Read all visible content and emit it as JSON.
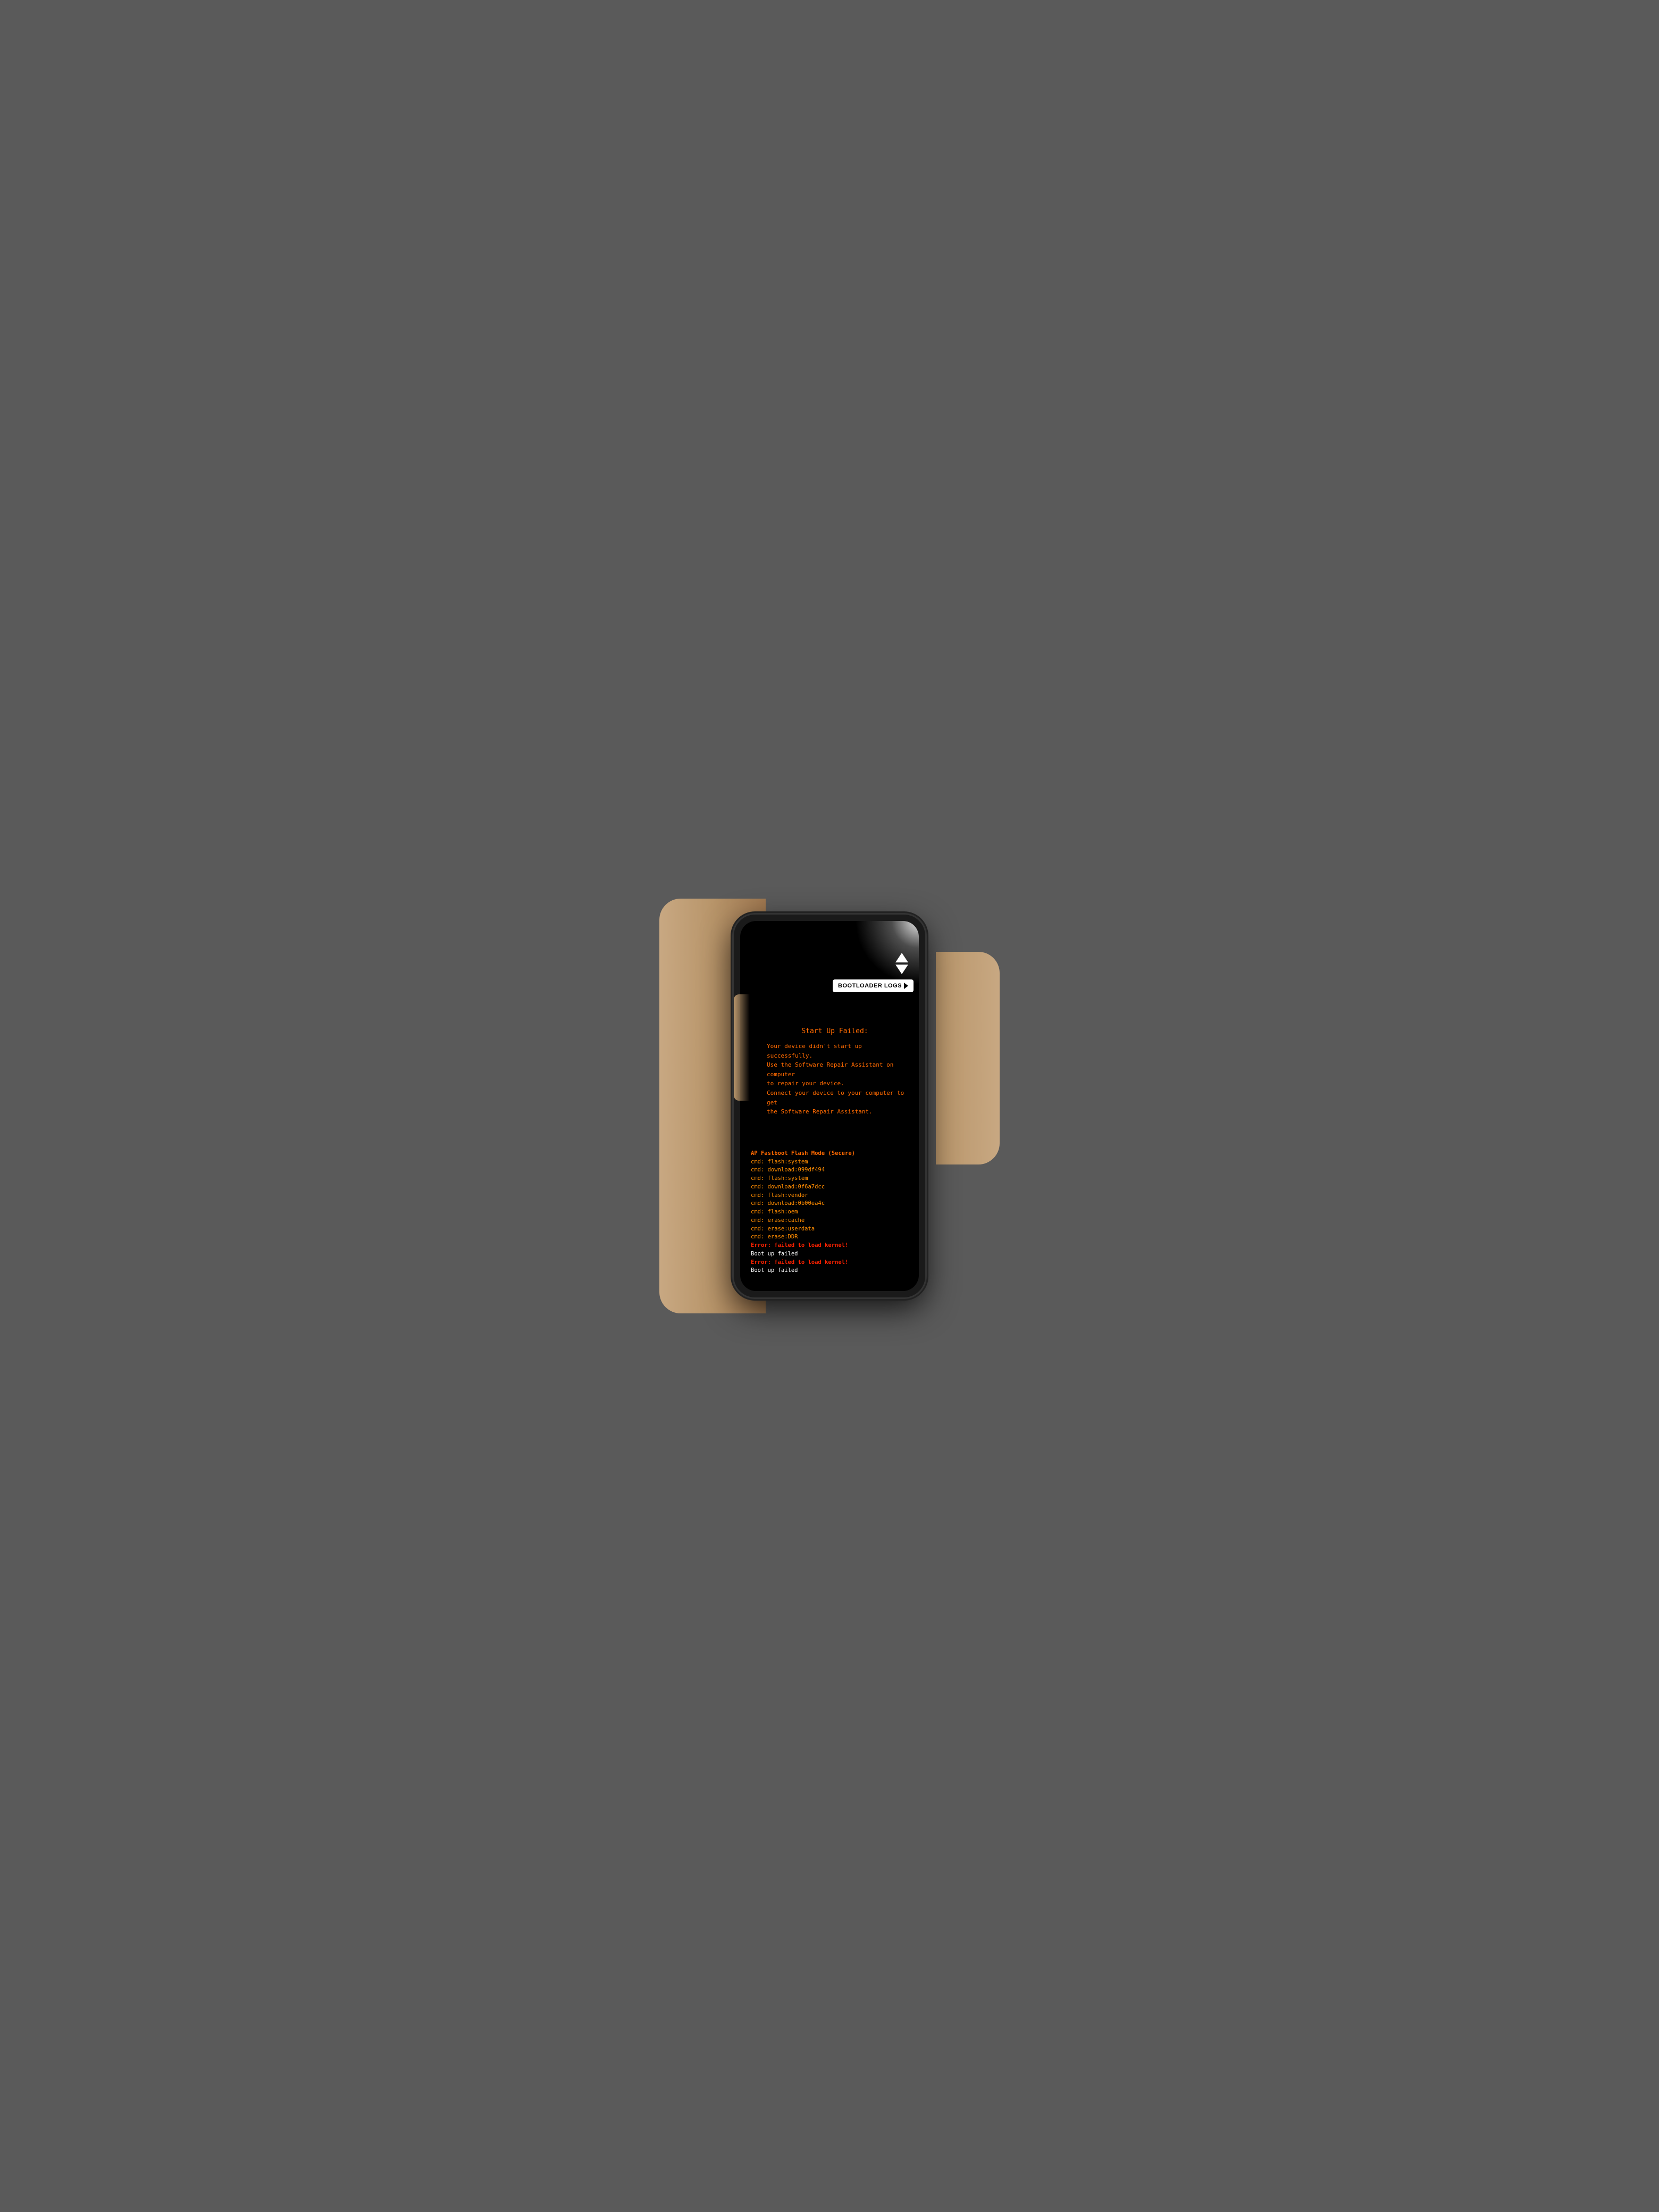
{
  "scene": {
    "background_color": "#5a5a5a"
  },
  "phone": {
    "screen_bg": "#000000"
  },
  "nav": {
    "up_arrow_label": "▲",
    "down_arrow_label": "▼"
  },
  "bootloader_button": {
    "label": "BOOTLOADER LOGS",
    "chevron": "▶"
  },
  "startup": {
    "title": "Start Up Failed:",
    "line1": "Your device didn't start up successfully.",
    "line2": "Use the Software Repair Assistant on computer",
    "line3": "to repair your device.",
    "line4": "Connect your device to your computer to get",
    "line5": "the Software Repair Assistant."
  },
  "log": {
    "header": "AP Fastboot Flash Mode (Secure)",
    "lines": [
      {
        "type": "cmd",
        "text": "cmd: flash:system"
      },
      {
        "type": "cmd",
        "text": "cmd: download:099df494"
      },
      {
        "type": "cmd",
        "text": "cmd: flash:system"
      },
      {
        "type": "cmd",
        "text": "cmd: download:0f6a7dcc"
      },
      {
        "type": "cmd",
        "text": "cmd: flash:vendor"
      },
      {
        "type": "cmd",
        "text": "cmd: download:0b00ea4c"
      },
      {
        "type": "cmd",
        "text": "cmd: flash:oem"
      },
      {
        "type": "cmd",
        "text": "cmd: erase:cache"
      },
      {
        "type": "cmd",
        "text": "cmd: erase:userdata"
      },
      {
        "type": "cmd",
        "text": "cmd: erase:DDR"
      },
      {
        "type": "error",
        "text": "Error: failed to load kernel!"
      },
      {
        "type": "white",
        "text": "Boot up failed"
      },
      {
        "type": "error",
        "text": "Error: failed to load kernel!"
      },
      {
        "type": "white",
        "text": "Boot up failed"
      }
    ]
  }
}
